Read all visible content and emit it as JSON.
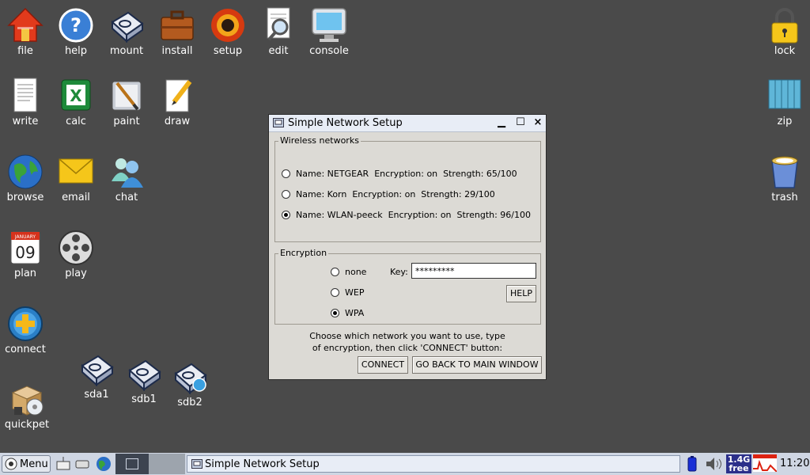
{
  "desktop": {
    "icons": [
      {
        "label": "file"
      },
      {
        "label": "help"
      },
      {
        "label": "mount"
      },
      {
        "label": "install"
      },
      {
        "label": "setup"
      },
      {
        "label": "edit"
      },
      {
        "label": "console"
      },
      {
        "label": "lock"
      },
      {
        "label": "write"
      },
      {
        "label": "calc"
      },
      {
        "label": "paint"
      },
      {
        "label": "draw"
      },
      {
        "label": "zip"
      },
      {
        "label": "browse"
      },
      {
        "label": "email"
      },
      {
        "label": "chat"
      },
      {
        "label": "trash"
      },
      {
        "label": "plan"
      },
      {
        "label": "play"
      },
      {
        "label": "connect"
      },
      {
        "label": "sda1"
      },
      {
        "label": "sdb1"
      },
      {
        "label": "sdb2"
      },
      {
        "label": "quickpet"
      }
    ],
    "plan_icon": {
      "month": "JANUARY",
      "day": "09"
    }
  },
  "window": {
    "title": "Simple Network Setup",
    "controls": {
      "minimize": "▁",
      "maximize": "☐",
      "close": "×"
    },
    "wireless": {
      "legend": "Wireless networks",
      "networks": [
        {
          "text": "Name: NETGEAR  Encryption: on  Strength: 65/100",
          "selected": false
        },
        {
          "text": "Name: Korn  Encryption: on  Strength: 29/100",
          "selected": false
        },
        {
          "text": "Name: WLAN-peeck  Encryption: on  Strength: 96/100",
          "selected": true
        }
      ]
    },
    "encryption": {
      "legend": "Encryption",
      "options": [
        {
          "label": "none",
          "selected": false
        },
        {
          "label": "WEP",
          "selected": false
        },
        {
          "label": "WPA",
          "selected": true
        }
      ],
      "key_label": "Key:",
      "key_value": "*********",
      "help_label": "HELP"
    },
    "instructions_line1": "Choose which network you want to use, type",
    "instructions_line2": "of encryption, then click 'CONNECT' button:",
    "connect_label": "CONNECT",
    "back_label": "GO BACK TO MAIN WINDOW"
  },
  "taskbar": {
    "menu_label": "Menu",
    "task_title": "Simple Network Setup",
    "free_top": "1.4G",
    "free_bottom": "free",
    "clock": "11:20"
  },
  "colors": {
    "desktop": "#4a4a4a",
    "taskbar": "#cfd6e3",
    "window": "#dcdad5"
  }
}
